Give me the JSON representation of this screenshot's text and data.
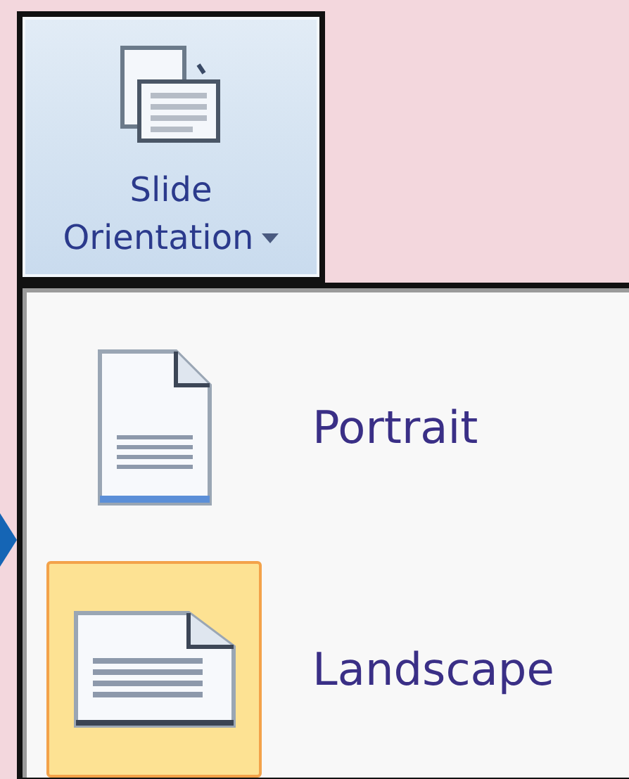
{
  "button": {
    "label": "Slide Orientation",
    "has_dropdown": true
  },
  "menu": {
    "items": [
      {
        "label": "Portrait",
        "kind": "portrait",
        "selected": false
      },
      {
        "label": "Landscape",
        "kind": "landscape",
        "selected": true
      }
    ]
  }
}
